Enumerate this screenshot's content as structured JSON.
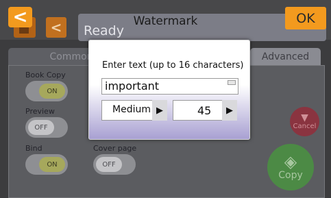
{
  "header": {
    "title": "Watermark",
    "status": "Ready",
    "back_glyph": "<",
    "prev_glyph": "<",
    "ok_label": "OK"
  },
  "tabs": [
    {
      "label": "Common",
      "active": false
    },
    {
      "label": "Advanced",
      "active": true
    }
  ],
  "settings": {
    "book_copy": {
      "label": "Book Copy",
      "value": "ON"
    },
    "preview": {
      "label": "Preview",
      "value": "OFF"
    },
    "bind": {
      "label": "Bind",
      "value": "ON"
    },
    "cover_page": {
      "label": "Cover page",
      "value": "OFF"
    }
  },
  "actions": {
    "cancel_label": "Cancel",
    "copy_label": "Copy"
  },
  "dialog": {
    "prompt": "Enter text (up to 16 characters)",
    "text_value": "important",
    "size_value": "Medium",
    "angle_value": "45",
    "arrow_glyph": "▶"
  },
  "colors": {
    "accent_orange": "#f39a1e",
    "cancel_red": "#8a3440",
    "copy_green": "#4c8a45"
  },
  "icons": [
    "back-icon",
    "home-icon",
    "keyboard-icon",
    "cancel-icon",
    "copy-icon"
  ]
}
